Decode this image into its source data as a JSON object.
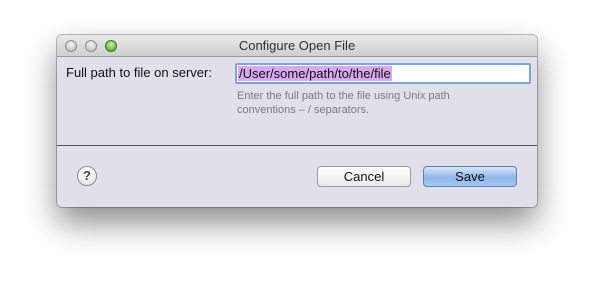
{
  "window": {
    "title": "Configure Open File"
  },
  "form": {
    "label": "Full path to file on server:",
    "path_value": "/User/some/path/to/the/file",
    "hint": "Enter the full path to the file using Unix path conventions – / separators."
  },
  "footer": {
    "help_label": "?",
    "cancel_label": "Cancel",
    "save_label": "Save"
  },
  "colors": {
    "selection": "#d9a9f0",
    "focus_ring": "#7aa6dc",
    "default_button": "#8fb6ea"
  }
}
